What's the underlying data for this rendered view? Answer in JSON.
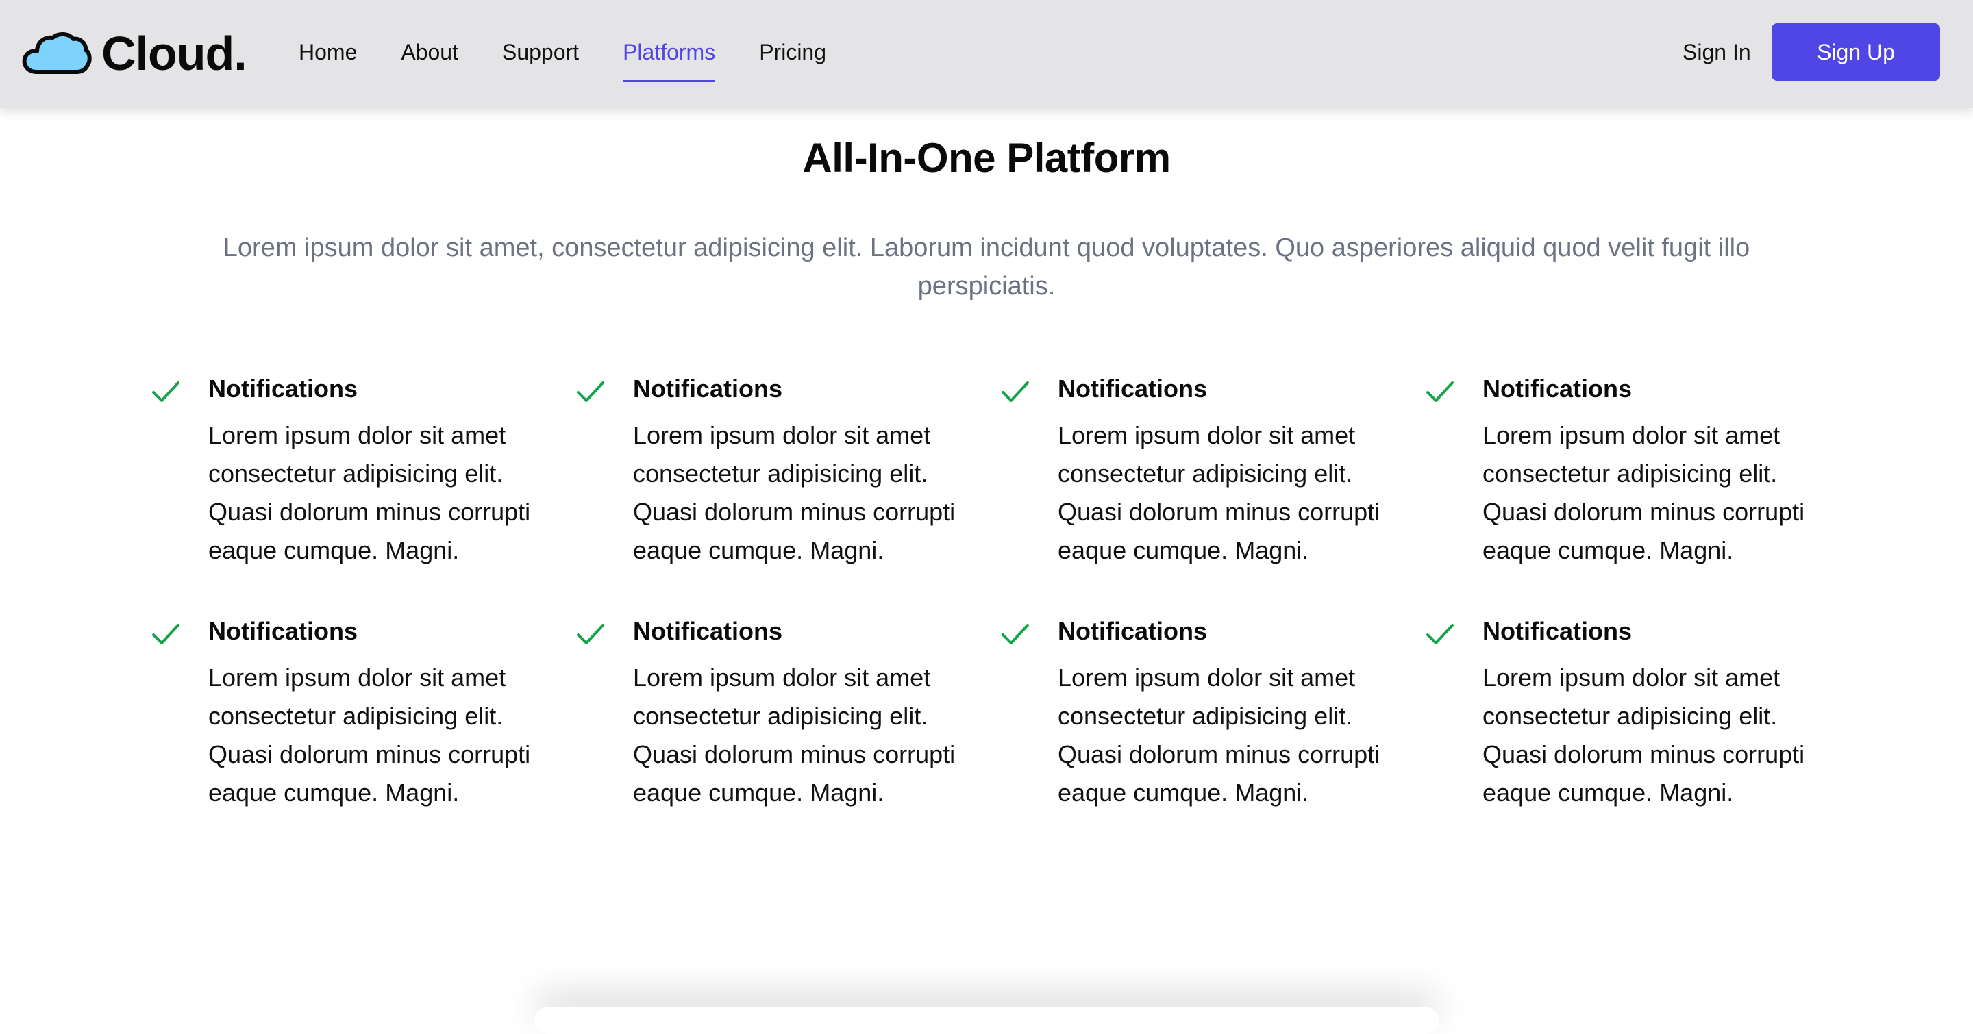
{
  "nav": {
    "brand": "Cloud.",
    "links": [
      {
        "label": "Home",
        "active": false
      },
      {
        "label": "About",
        "active": false
      },
      {
        "label": "Support",
        "active": false
      },
      {
        "label": "Platforms",
        "active": true
      },
      {
        "label": "Pricing",
        "active": false
      }
    ],
    "sign_in": "Sign In",
    "sign_up": "Sign Up"
  },
  "hero": {
    "title": "All-In-One Platform",
    "subtitle": "Lorem ipsum dolor sit amet, consectetur adipisicing elit. Laborum incidunt quod voluptates. Quo asperiores aliquid quod velit fugit illo perspiciatis."
  },
  "features": [
    {
      "title": "Notifications",
      "text": "Lorem ipsum dolor sit amet consectetur adipisicing elit. Quasi dolorum minus corrupti eaque cumque. Magni."
    },
    {
      "title": "Notifications",
      "text": "Lorem ipsum dolor sit amet consectetur adipisicing elit. Quasi dolorum minus corrupti eaque cumque. Magni."
    },
    {
      "title": "Notifications",
      "text": "Lorem ipsum dolor sit amet consectetur adipisicing elit. Quasi dolorum minus corrupti eaque cumque. Magni."
    },
    {
      "title": "Notifications",
      "text": "Lorem ipsum dolor sit amet consectetur adipisicing elit. Quasi dolorum minus corrupti eaque cumque. Magni."
    },
    {
      "title": "Notifications",
      "text": "Lorem ipsum dolor sit amet consectetur adipisicing elit. Quasi dolorum minus corrupti eaque cumque. Magni."
    },
    {
      "title": "Notifications",
      "text": "Lorem ipsum dolor sit amet consectetur adipisicing elit. Quasi dolorum minus corrupti eaque cumque. Magni."
    },
    {
      "title": "Notifications",
      "text": "Lorem ipsum dolor sit amet consectetur adipisicing elit. Quasi dolorum minus corrupti eaque cumque. Magni."
    },
    {
      "title": "Notifications",
      "text": "Lorem ipsum dolor sit amet consectetur adipisicing elit. Quasi dolorum minus corrupti eaque cumque. Magni."
    }
  ],
  "icons": {
    "logo": "cloud-icon",
    "feature": "check-icon"
  },
  "colors": {
    "accent": "#4f46e5",
    "navbar_bg": "#e4e4e7",
    "check": "#16a34a",
    "cloud_fill": "#7dd3fc",
    "subtitle": "#6b7280"
  }
}
